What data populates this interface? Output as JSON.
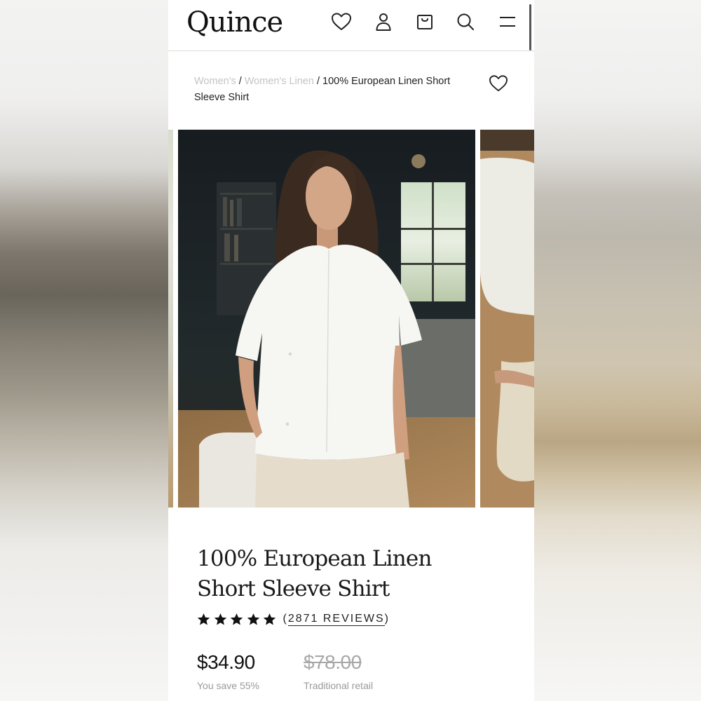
{
  "header": {
    "logo": "Quince",
    "icons": [
      "heart-icon",
      "account-icon",
      "cart-icon",
      "search-icon",
      "menu-icon"
    ]
  },
  "breadcrumb": {
    "items": [
      "Women's",
      "Women's Linen",
      "100% European Linen Short Sleeve Shirt"
    ],
    "separator": "/"
  },
  "product": {
    "title": "100% European Linen Short Sleeve Shirt",
    "rating_stars": 5,
    "reviews_label": "2871 REVIEWS",
    "reviews_open": "(",
    "reviews_close": ")",
    "price": "$34.90",
    "savings": "You save 55%",
    "retail_price": "$78.00",
    "retail_label": "Traditional retail"
  },
  "colors": {
    "text": "#111111",
    "muted": "#9a9a9a",
    "breadcrumb_link": "#c4c4c4"
  }
}
